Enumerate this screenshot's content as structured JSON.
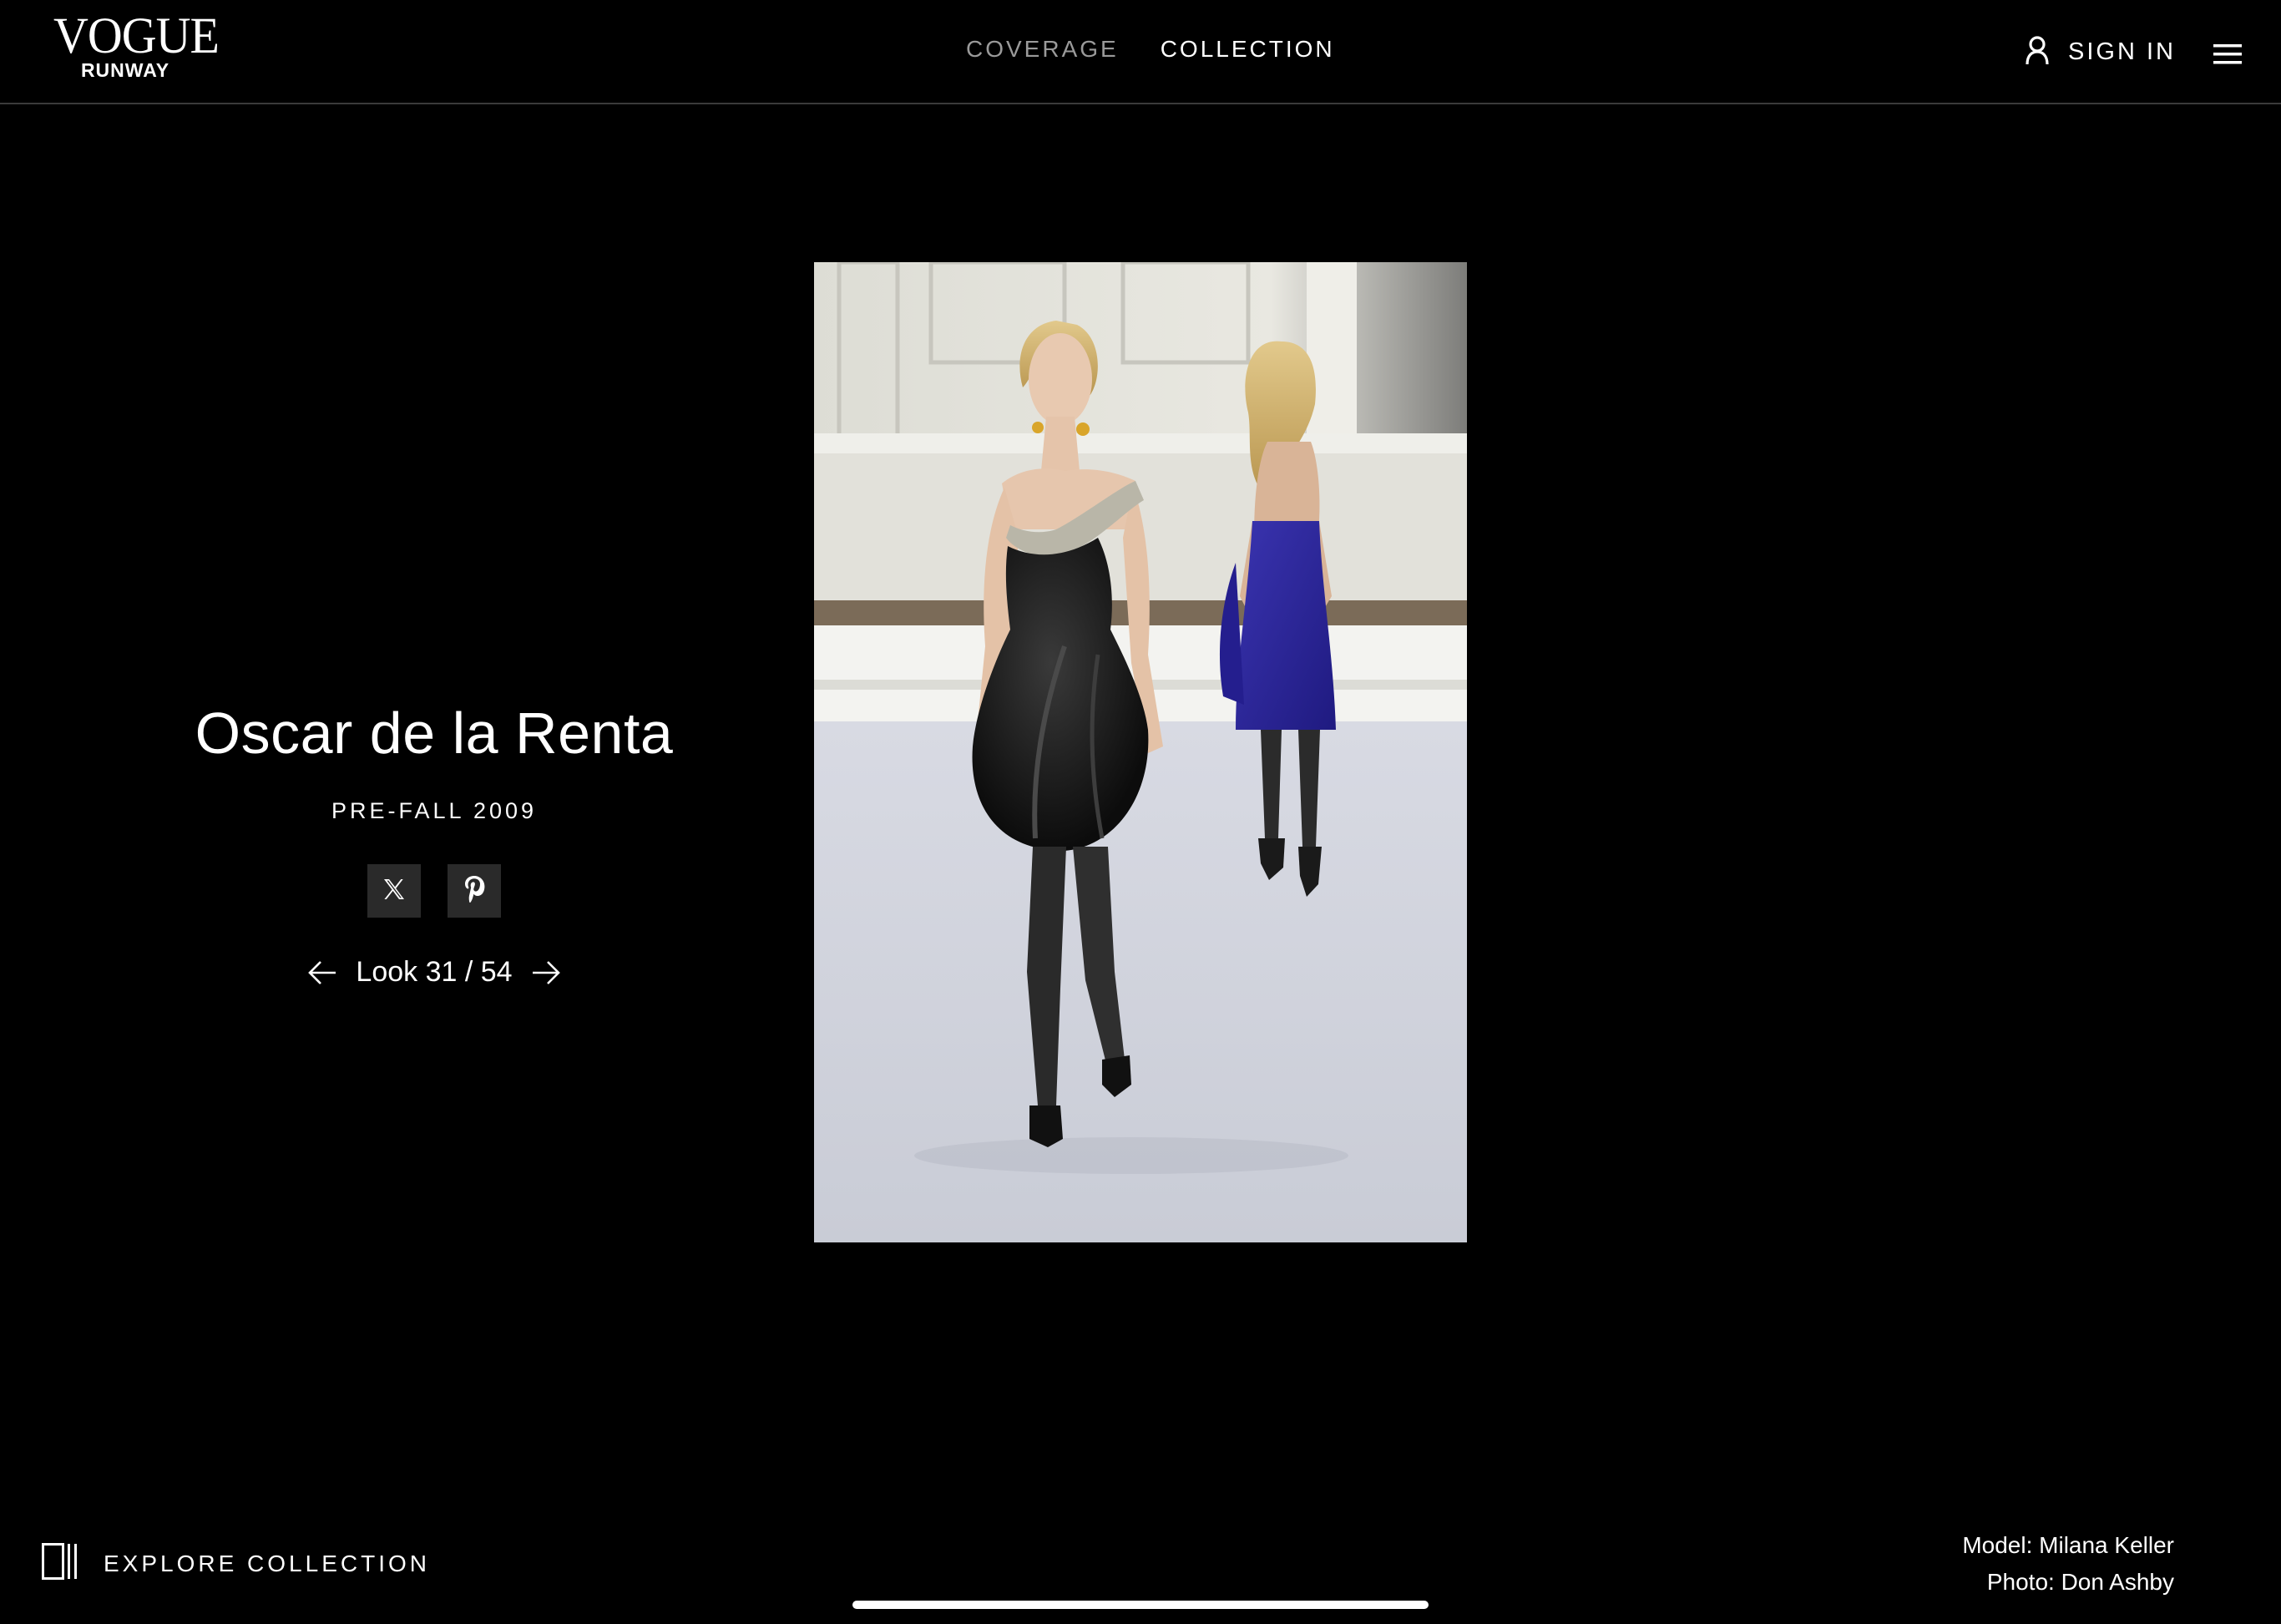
{
  "header": {
    "logo_top": "VOGUE",
    "logo_bottom": "RUNWAY",
    "tabs": [
      {
        "label": "COVERAGE",
        "active": false
      },
      {
        "label": "COLLECTION",
        "active": true
      }
    ],
    "signin_label": "SIGN IN",
    "signin_icon": "user-icon",
    "menu_icon": "hamburger-menu-icon"
  },
  "show": {
    "designer": "Oscar de la Renta",
    "season": "PRE-FALL 2009",
    "share": [
      {
        "icon": "x-twitter-icon"
      },
      {
        "icon": "pinterest-icon"
      }
    ],
    "look": {
      "label": "Look 31 / 54",
      "current": 31,
      "total": 54
    }
  },
  "footer": {
    "explore_label": "EXPLORE COLLECTION",
    "explore_icon": "gallery-grid-icon",
    "model_credit": "Model: Milana Keller",
    "photo_credit": "Photo: Don Ashby"
  },
  "colors": {
    "background": "#000000",
    "text": "#ffffff",
    "inactive_tab": "#9a9a9a",
    "share_button_bg": "#2a2a2a",
    "divider": "#3a3a3a"
  }
}
